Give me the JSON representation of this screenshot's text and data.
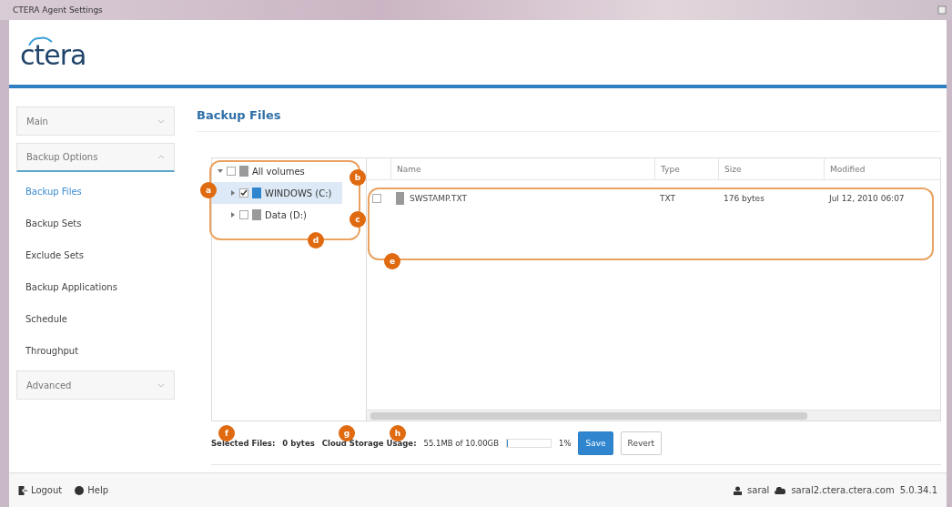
{
  "window": {
    "title": "CTERA Agent Settings"
  },
  "logo": {
    "text": "ctera"
  },
  "sidebar": {
    "items": [
      {
        "kind": "header",
        "label": "Main",
        "expanded": false
      },
      {
        "kind": "header",
        "label": "Backup Options",
        "expanded": true
      },
      {
        "kind": "link",
        "label": "Backup Files",
        "selected": true
      },
      {
        "kind": "link",
        "label": "Backup Sets",
        "selected": false
      },
      {
        "kind": "link",
        "label": "Exclude Sets",
        "selected": false
      },
      {
        "kind": "link",
        "label": "Backup Applications",
        "selected": false
      },
      {
        "kind": "link",
        "label": "Schedule",
        "selected": false
      },
      {
        "kind": "link",
        "label": "Throughput",
        "selected": false
      },
      {
        "kind": "header",
        "label": "Advanced",
        "expanded": false
      }
    ]
  },
  "page": {
    "title": "Backup Files"
  },
  "tree": {
    "items": [
      {
        "label": "All volumes",
        "checked": false,
        "expanded": true,
        "selected": false,
        "children": [
          {
            "label": "WINDOWS (C:)",
            "checked": true,
            "expanded": false,
            "selected": true
          },
          {
            "label": "Data (D:)",
            "checked": false,
            "expanded": false,
            "selected": false
          }
        ]
      }
    ]
  },
  "table": {
    "columns": [
      "Name",
      "Type",
      "Size",
      "Modified"
    ],
    "rows": [
      {
        "checked": false,
        "cells": [
          "SWSTAMP.TXT",
          "TXT",
          "176 bytes",
          "Jul 12, 2010 06:07"
        ]
      }
    ]
  },
  "annotations": [
    {
      "label": "a"
    },
    {
      "label": "b"
    },
    {
      "label": "c"
    },
    {
      "label": "d"
    },
    {
      "label": "e"
    },
    {
      "label": "f"
    },
    {
      "label": "g"
    },
    {
      "label": "h"
    }
  ],
  "status": {
    "selected_label": "Selected Files:",
    "selected_value": "0 bytes",
    "usage_label": "Cloud Storage Usage:",
    "usage_value": "55.1MB of 10.00GB",
    "usage": {
      "level": 0.01
    },
    "percent": "1%"
  },
  "buttons": [
    {
      "label": "Save",
      "kind": "primary"
    },
    {
      "label": "Revert",
      "kind": "secondary"
    }
  ],
  "footer": {
    "links": [
      "Logout",
      "Help"
    ],
    "user": "saral",
    "server": "saral2.ctera.ctera.com",
    "version": "5.0.34.1"
  }
}
